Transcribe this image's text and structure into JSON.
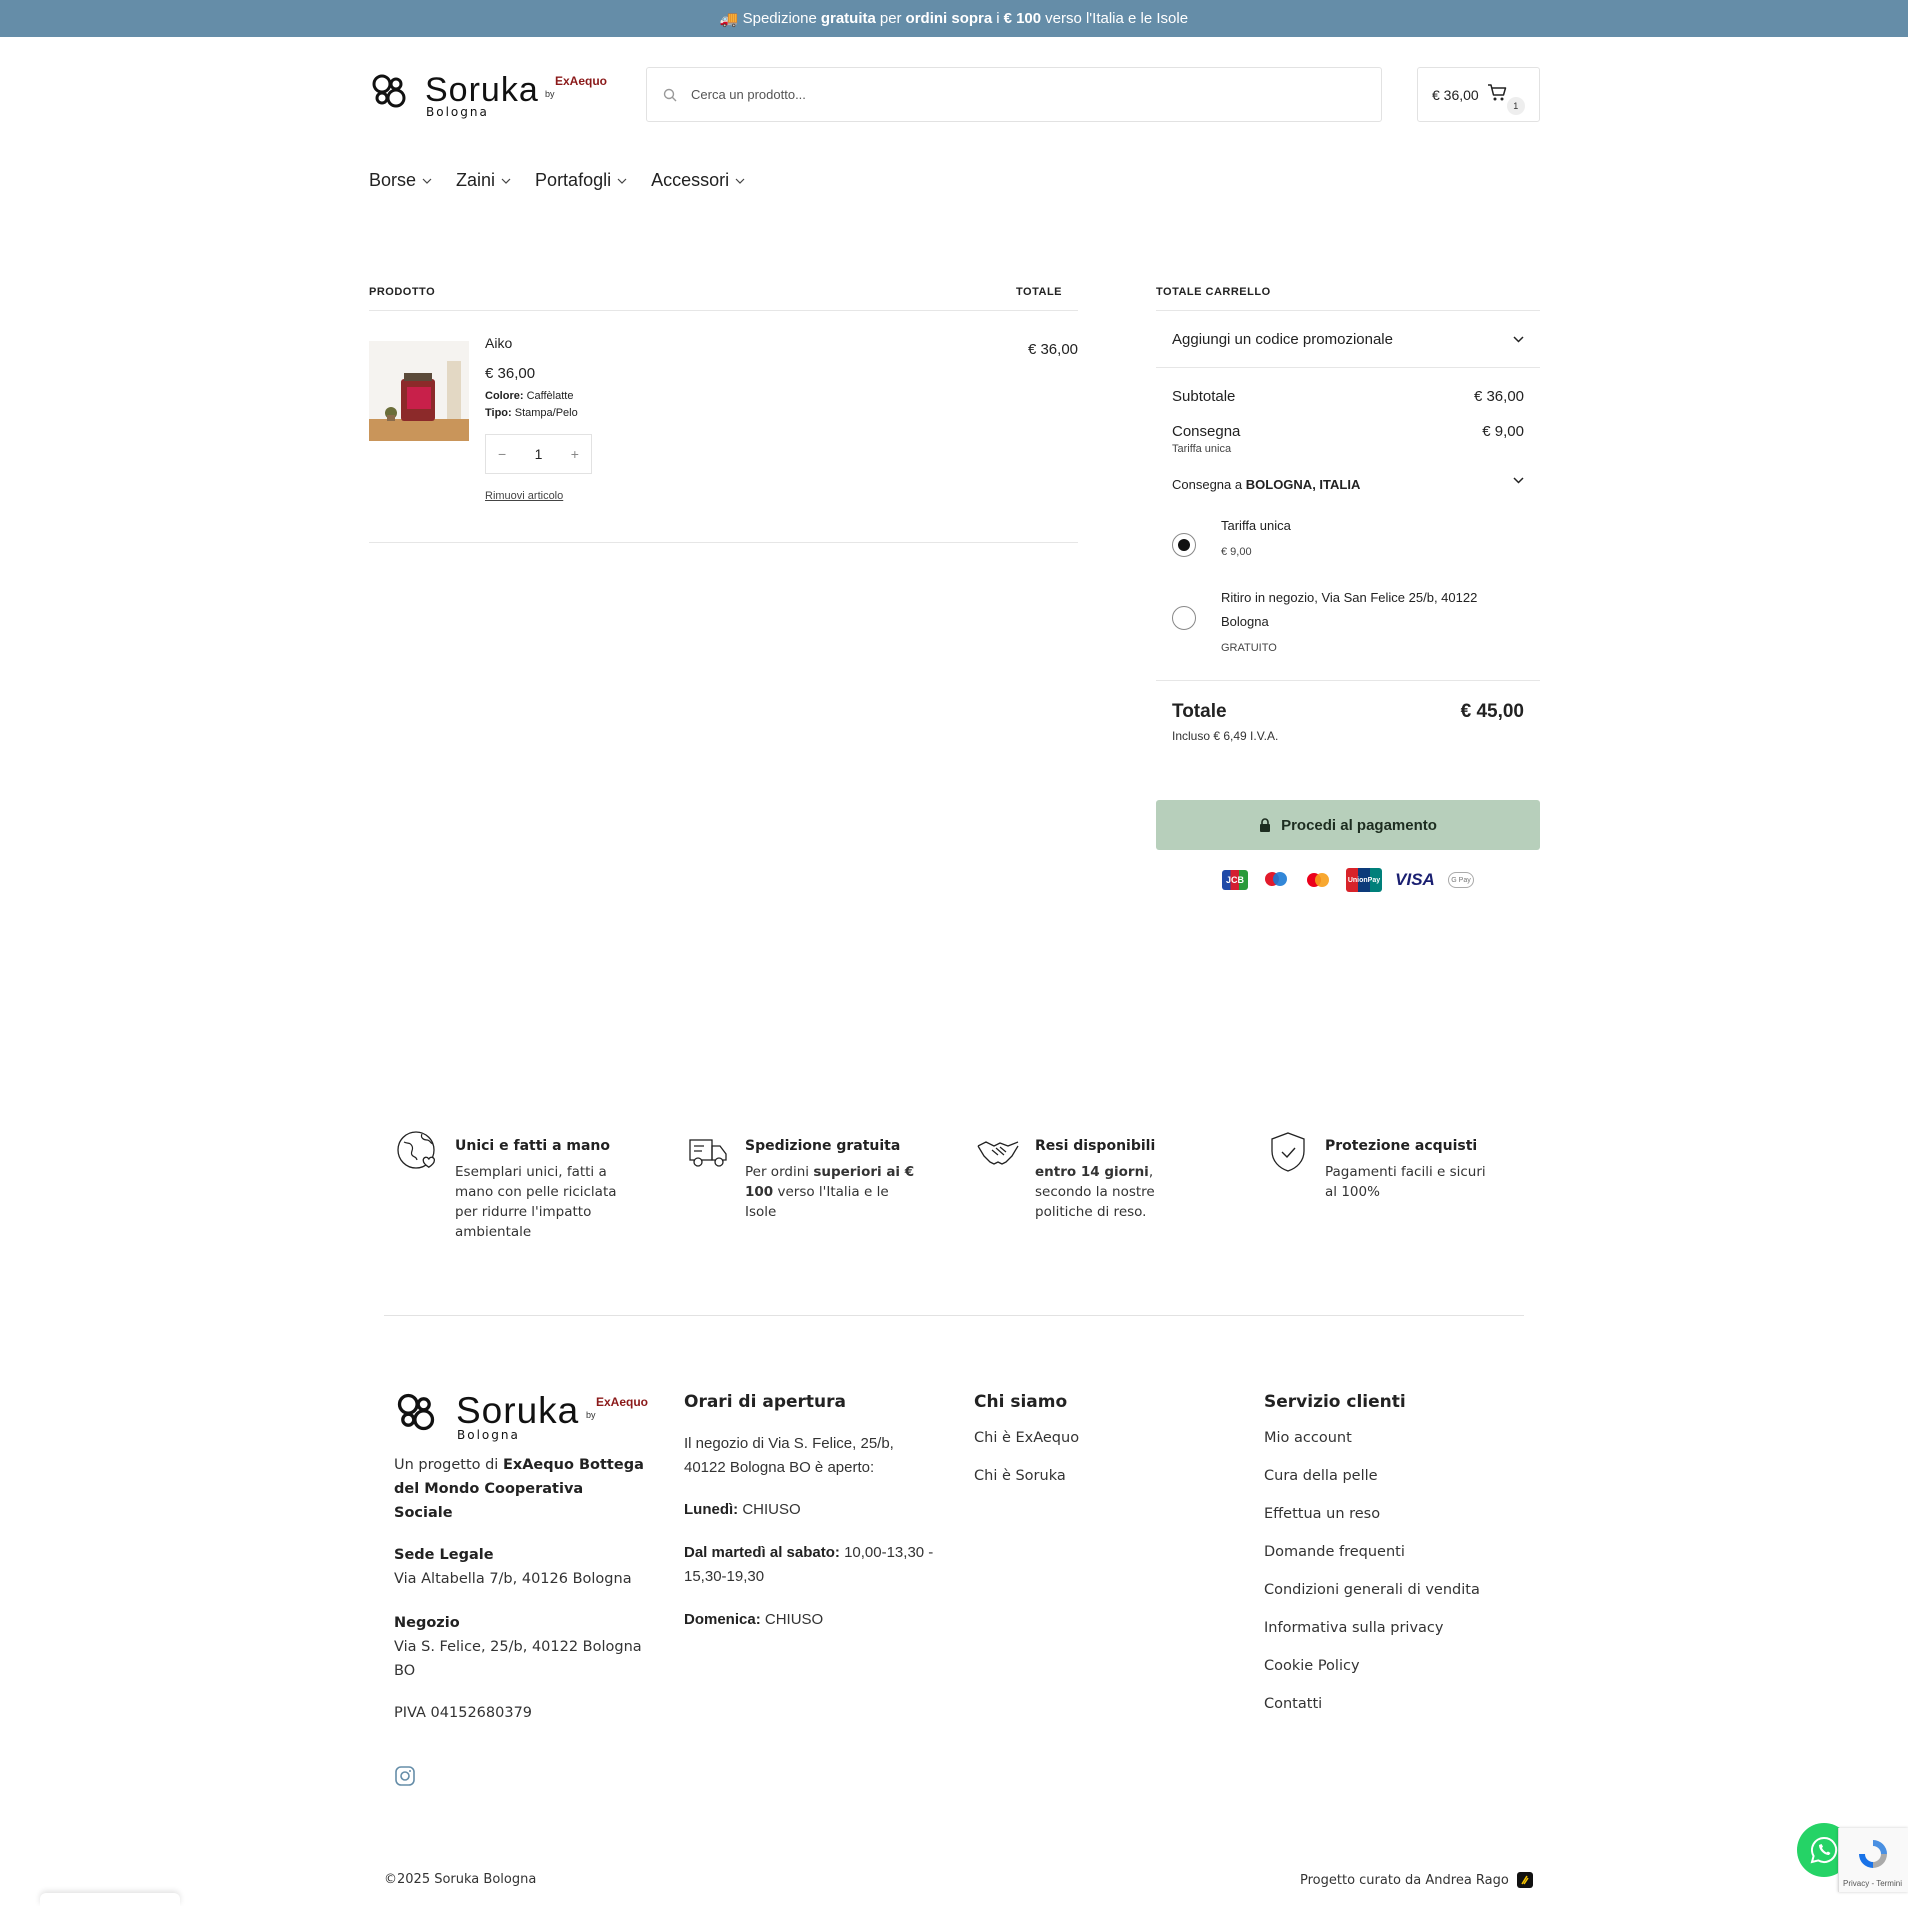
{
  "announcement": {
    "part1": "Spedizione",
    "part2": "gratuita",
    "part3": "per",
    "part4": "ordini sopra",
    "part5": "i",
    "part6": "€ 100",
    "part7": "verso l'Italia e le Isole"
  },
  "logo": {
    "name": "Soruka",
    "city": "Bologna",
    "by": "by",
    "brand": "ExAequo"
  },
  "search": {
    "placeholder": "Cerca un prodotto..."
  },
  "cart": {
    "total": "€ 36,00",
    "count": "1"
  },
  "nav": [
    "Borse",
    "Zaini",
    "Portafogli",
    "Accessori"
  ],
  "cart_table": {
    "col_product": "PRODOTTO",
    "col_total": "TOTALE",
    "item": {
      "name": "Aiko",
      "price": "€ 36,00",
      "attr1_label": "Colore:",
      "attr1_value": "Caffèlatte",
      "attr2_label": "Tipo:",
      "attr2_value": "Stampa/Pelo",
      "qty": "1",
      "remove": "Rimuovi articolo",
      "total": "€ 36,00"
    }
  },
  "totals": {
    "heading": "TOTALE CARRELLO",
    "promo": "Aggiungi un codice promozionale",
    "subtotal_label": "Subtotale",
    "subtotal_value": "€ 36,00",
    "shipping_label": "Consegna",
    "shipping_value": "€ 9,00",
    "shipping_sub": "Tariffa unica",
    "ship_to_label": "Consegna a",
    "ship_to_value": "BOLOGNA, ITALIA",
    "options": [
      {
        "label": "Tariffa unica",
        "price": "€ 9,00",
        "selected": true
      },
      {
        "label": "Ritiro in negozio, Via San Felice 25/b, 40122 Bologna",
        "price": "GRATUITO",
        "selected": false
      }
    ],
    "total_label": "Totale",
    "total_value": "€ 45,00",
    "vat": "Incluso € 6,49 I.V.A.",
    "checkout": "Procedi al pagamento",
    "payments": [
      "JCB",
      "Maestro",
      "Mastercard",
      "UnionPay",
      "VISA",
      "G Pay"
    ]
  },
  "features": [
    {
      "title": "Unici e fatti a mano",
      "desc": "Esemplari unici, fatti a mano con pelle riciclata per ridurre l'impatto ambientale",
      "icon": "earth-heart-icon"
    },
    {
      "title": "Spedizione gratuita",
      "desc_pre": "Per ordini",
      "desc_bold": "superiori ai € 100",
      "desc_post": "verso l'Italia e le Isole",
      "icon": "truck-icon"
    },
    {
      "title": "Resi disponibili",
      "desc_bold": "entro 14 giorni",
      "desc_post": ", secondo la nostre politiche di reso.",
      "icon": "handshake-icon"
    },
    {
      "title": "Protezione acquisti",
      "desc": "Pagamenti facili e sicuri al 100%",
      "icon": "shield-check-icon"
    }
  ],
  "footer": {
    "about_pre": "Un progetto di",
    "about_bold": "ExAequo Bottega del Mondo Cooperativa Sociale",
    "legal_label": "Sede Legale",
    "legal_addr": "Via Altabella 7/b, 40126 Bologna",
    "shop_label": "Negozio",
    "shop_addr": "Via S. Felice, 25/b, 40122 Bologna BO",
    "piva": "PIVA 04152680379",
    "hours_title": "Orari di apertura",
    "hours_intro": "Il negozio di Via S. Felice, 25/b, 40122 Bologna BO è aperto:",
    "mon_label": "Lunedì:",
    "mon_value": "CHIUSO",
    "tue_label": "Dal martedì al sabato:",
    "tue_value": "10,00-13,30 - 15,30-19,30",
    "sun_label": "Domenica:",
    "sun_value": "CHIUSO",
    "about_title": "Chi siamo",
    "about_links": [
      "Chi è ExAequo",
      "Chi è Soruka"
    ],
    "service_title": "Servizio clienti",
    "service_links": [
      "Mio account",
      "Cura della pelle",
      "Effettua un reso",
      "Domande frequenti",
      "Condizioni generali di vendita",
      "Informativa sulla privacy",
      "Cookie Policy",
      "Contatti"
    ],
    "copyright": "©2025 Soruka Bologna",
    "credit": "Progetto curato da Andrea Rago"
  },
  "recaptcha": "Privacy - Termini",
  "colors": {
    "topbar": "#658da8",
    "checkout": "#b7cfbb",
    "whatsapp": "#25d366"
  }
}
